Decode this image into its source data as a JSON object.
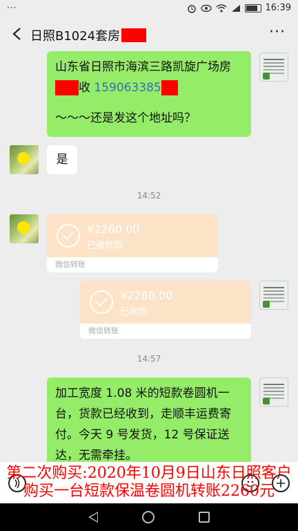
{
  "status_bar": {
    "left_dots": "···",
    "icons": [
      "alarm-icon",
      "eye-icon",
      "wifi-icon",
      "signal-icon",
      "battery-icon"
    ],
    "time": "16:39"
  },
  "header": {
    "back_icon": "chevron-left-icon",
    "title": "日照B1024套房",
    "more_icon": "ellipsis-icon"
  },
  "messages": {
    "address": {
      "line1": "山东省日照市海滨三路凯旋广场房",
      "line2_suffix": "收",
      "phone": "159063385",
      "question": "～～～还是发这个地址吗？"
    },
    "reply": "是",
    "time1": "14:52",
    "transfer_received": {
      "amount": "¥2260.00",
      "status": "已被领取",
      "label": "微信转账"
    },
    "transfer_sent": {
      "amount": "¥2260.00",
      "status": "已收款",
      "label": "微信转账"
    },
    "time2": "14:57",
    "shipping": "加工宽度 1.08 米的短款卷圆机一台，货款已经收到，走顺丰运费寄付。今天 9 号发货，12 号保证送达，无需牵挂。"
  },
  "caption": {
    "line1": "第二次购买:2020年10月9日山东日照客户",
    "line2": "购买一台短款保温卷圆机转账2260元"
  },
  "input_bar": {
    "voice_icon": "voice-icon",
    "emoji_icon": "emoji-icon",
    "plus_icon": "plus-icon"
  },
  "system_nav": {
    "icons": [
      "back-triangle-icon",
      "home-circle-icon",
      "recents-square-icon"
    ]
  },
  "colors": {
    "accent_green": "#95ec69",
    "transfer_orange": "#fce3c7",
    "redaction": "#ff0000"
  }
}
